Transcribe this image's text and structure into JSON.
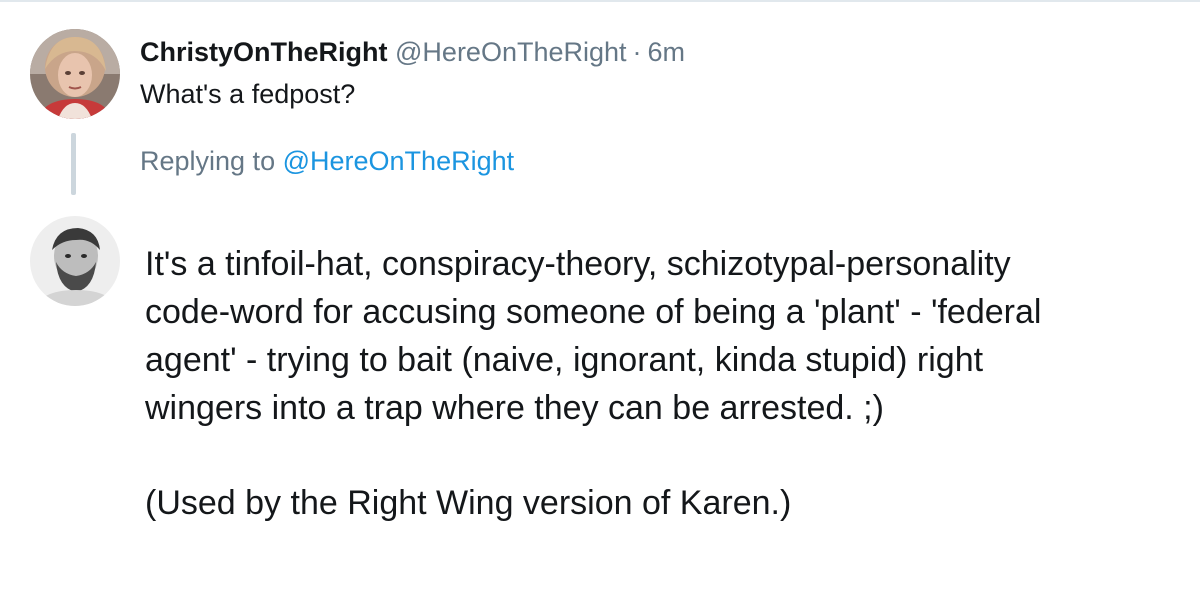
{
  "tweet": {
    "display_name": "ChristyOnTheRight",
    "handle": "@HereOnTheRight",
    "separator": "·",
    "time": "6m",
    "text": "What's a fedpost?"
  },
  "reply": {
    "replying_prefix": "Replying to",
    "replying_handle": "@HereOnTheRight",
    "lines": [
      "It's a tinfoil-hat, conspiracy-theory, schizotypal-personality",
      "code-word for accusing someone of being a 'plant' - 'federal",
      "agent' - trying to bait (naive, ignorant, kinda stupid) right",
      "wingers into a trap where they can be arrested. ;)"
    ],
    "footnote": "(Used by the Right Wing version of Karen.)"
  },
  "colors": {
    "text": "#14171a",
    "muted": "#657786",
    "link": "#1b95e0",
    "border": "#e1e8ed",
    "thread_line": "#ccd6dd"
  }
}
